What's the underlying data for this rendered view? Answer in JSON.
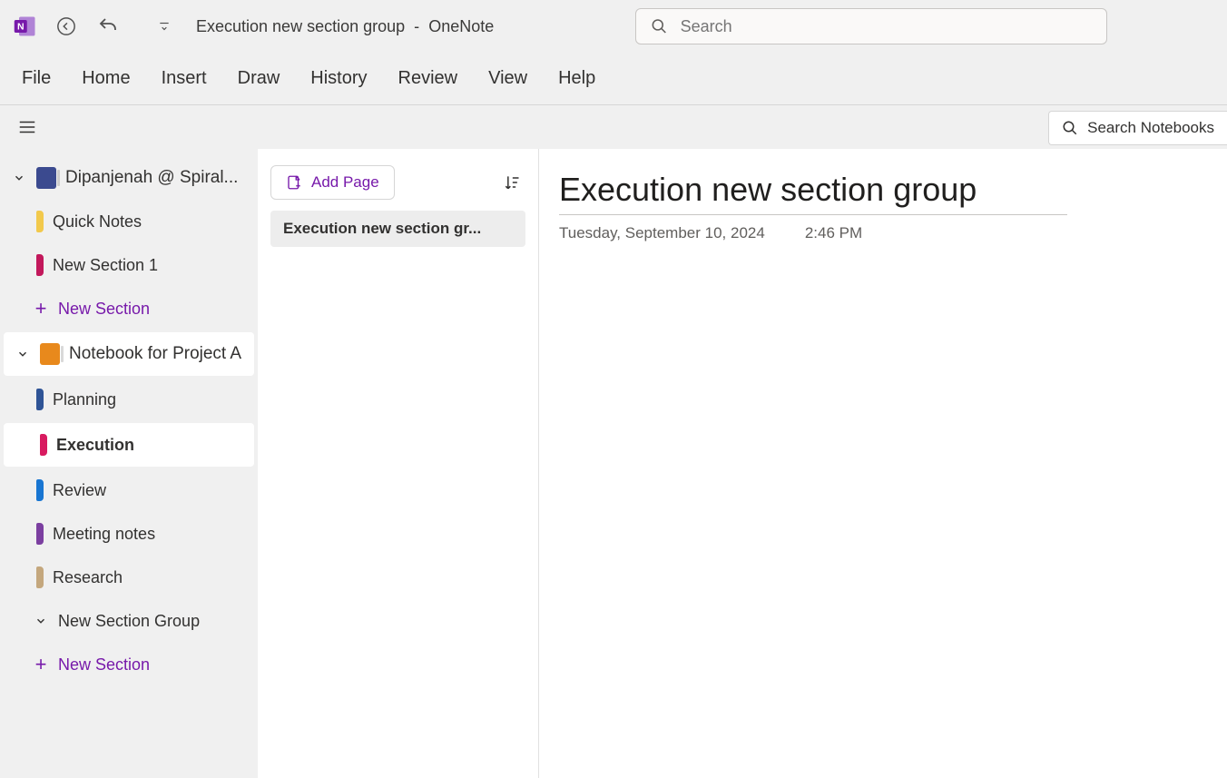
{
  "titlebar": {
    "document_title": "Execution new section group",
    "separator": "-",
    "app_name": "OneNote",
    "search_placeholder": "Search"
  },
  "ribbon": {
    "tabs": [
      "File",
      "Home",
      "Insert",
      "Draw",
      "History",
      "Review",
      "View",
      "Help"
    ]
  },
  "secondary": {
    "search_notebooks_label": "Search Notebooks"
  },
  "sidebar": {
    "notebooks": [
      {
        "name": "Dipanjenah @ Spiral...",
        "color": "#3b4a8f",
        "expanded": true,
        "selected": false,
        "sections": [
          {
            "name": "Quick Notes",
            "color": "#f2c94c",
            "selected": false
          },
          {
            "name": "New Section 1",
            "color": "#c2185b",
            "selected": false
          }
        ],
        "new_section_label": "New Section"
      },
      {
        "name": "Notebook for Project A",
        "color": "#e8891c",
        "expanded": true,
        "selected": true,
        "sections": [
          {
            "name": "Planning",
            "color": "#2f5496",
            "selected": false
          },
          {
            "name": "Execution",
            "color": "#d81b60",
            "selected": true
          },
          {
            "name": "Review",
            "color": "#1976d2",
            "selected": false
          },
          {
            "name": "Meeting notes",
            "color": "#7b3fa0",
            "selected": false
          },
          {
            "name": "Research",
            "color": "#c4a77d",
            "selected": false
          }
        ],
        "section_groups": [
          {
            "name": "New Section Group"
          }
        ],
        "new_section_label": "New Section"
      }
    ]
  },
  "pages": {
    "add_page_label": "Add Page",
    "items": [
      {
        "title": "Execution new section gr...",
        "active": true
      }
    ]
  },
  "content": {
    "title": "Execution new section group",
    "date": "Tuesday, September 10, 2024",
    "time": "2:46 PM"
  }
}
